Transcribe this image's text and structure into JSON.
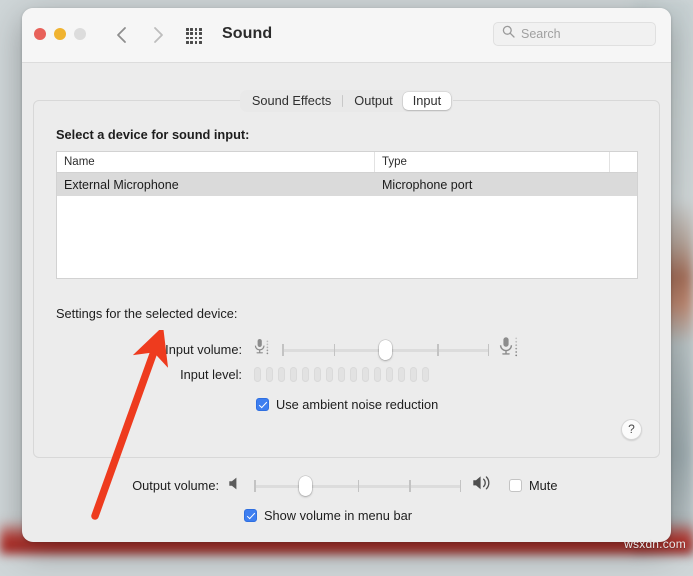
{
  "window": {
    "title": "Sound",
    "traffic_lights": {
      "close": "close-button",
      "minimize": "minimize-button",
      "maximize": "maximize-button"
    },
    "nav": {
      "back": "back-chevron-icon",
      "forward": "forward-chevron-icon",
      "grid": "show-all-grid-icon"
    },
    "search": {
      "placeholder": "Search",
      "value": ""
    }
  },
  "tabs": [
    {
      "label": "Sound Effects",
      "selected": false
    },
    {
      "label": "Output",
      "selected": false
    },
    {
      "label": "Input",
      "selected": true
    }
  ],
  "input_pane": {
    "select_device_label": "Select a device for sound input:",
    "table": {
      "columns": [
        "Name",
        "Type"
      ],
      "rows": [
        {
          "name": "External Microphone",
          "type": "Microphone port",
          "selected": true
        }
      ]
    },
    "settings_label": "Settings for the selected device:",
    "input_volume": {
      "label": "Input volume:",
      "value_percent": 50,
      "ticks": 5,
      "left_icon": "microphone-small-icon",
      "right_icon": "microphone-large-icon"
    },
    "input_level": {
      "label": "Input level:",
      "segments": 15,
      "lit": 0
    },
    "ambient_noise": {
      "label": "Use ambient noise reduction",
      "checked": true
    },
    "help_button": "?"
  },
  "output_row": {
    "label": "Output volume:",
    "value_percent": 25,
    "ticks": 5,
    "left_icon": "speaker-low-icon",
    "right_icon": "speaker-high-icon",
    "mute": {
      "label": "Mute",
      "checked": false
    }
  },
  "show_volume_row": {
    "label": "Show volume in menu bar",
    "checked": true
  },
  "annotation": {
    "type": "red-arrow",
    "color": "#EE3B1E",
    "points_to": "Input volume:"
  },
  "watermark": {
    "text": "wsxdn.com"
  },
  "colors": {
    "accent_blue": "#3D7EF0",
    "window_bg": "#ECECEC",
    "titlebar_bg": "#F6F6F6",
    "row_selected": "#DADADA",
    "annotation_red": "#EE3B1E"
  }
}
